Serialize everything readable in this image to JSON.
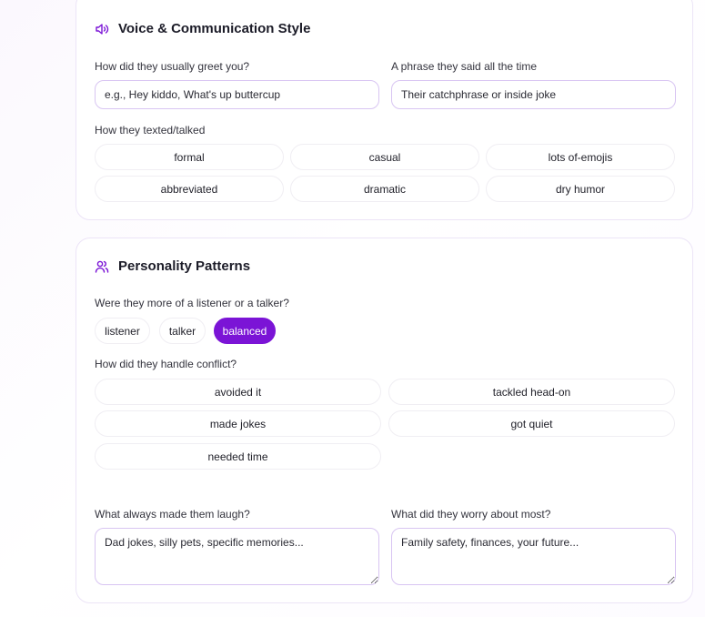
{
  "voice": {
    "title": "Voice & Communication Style",
    "icon": "speaker-icon",
    "greet_label": "How did they usually greet you?",
    "greet_placeholder": "e.g., Hey kiddo, What's up buttercup",
    "phrase_label": "A phrase they said all the time",
    "phrase_placeholder": "Their catchphrase or inside joke",
    "texting_label": "How they texted/talked",
    "texting_options": [
      "formal",
      "casual",
      "lots of-emojis",
      "abbreviated",
      "dramatic",
      "dry humor"
    ]
  },
  "personality": {
    "title": "Personality Patterns",
    "icon": "users-icon",
    "listener_label": "Were they more of a listener or a talker?",
    "listener_options": [
      "listener",
      "talker",
      "balanced"
    ],
    "listener_selected": "balanced",
    "conflict_label": "How did they handle conflict?",
    "conflict_options": [
      "avoided it",
      "tackled head-on",
      "made jokes",
      "got quiet",
      "needed time"
    ],
    "laugh_label": "What always made them laugh?",
    "laugh_placeholder": "Dad jokes, silly pets, specific memories...",
    "worry_label": "What did they worry about most?",
    "worry_placeholder": "Family safety, finances, your future..."
  },
  "colors": {
    "accent": "#7b14d6",
    "field_border": "#d8c5f2",
    "card_border": "#ece4f7"
  }
}
